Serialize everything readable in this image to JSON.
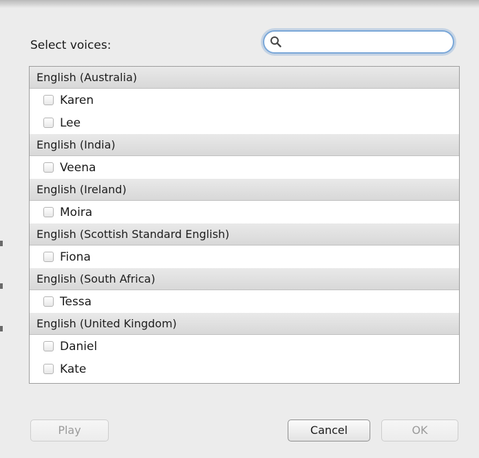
{
  "dialog": {
    "select_label": "Select voices:",
    "search": {
      "value": "",
      "placeholder": ""
    }
  },
  "groups": [
    {
      "header": "English (Australia)",
      "voices": [
        {
          "name": "Karen",
          "checked": false
        },
        {
          "name": "Lee",
          "checked": false
        }
      ]
    },
    {
      "header": "English (India)",
      "voices": [
        {
          "name": "Veena",
          "checked": false
        }
      ]
    },
    {
      "header": "English (Ireland)",
      "voices": [
        {
          "name": "Moira",
          "checked": false
        }
      ]
    },
    {
      "header": "English (Scottish Standard English)",
      "voices": [
        {
          "name": "Fiona",
          "checked": false
        }
      ]
    },
    {
      "header": "English (South Africa)",
      "voices": [
        {
          "name": "Tessa",
          "checked": false
        }
      ]
    },
    {
      "header": "English (United Kingdom)",
      "voices": [
        {
          "name": "Daniel",
          "checked": false
        },
        {
          "name": "Kate",
          "checked": false
        }
      ]
    }
  ],
  "buttons": {
    "play": "Play",
    "cancel": "Cancel",
    "ok": "OK"
  }
}
